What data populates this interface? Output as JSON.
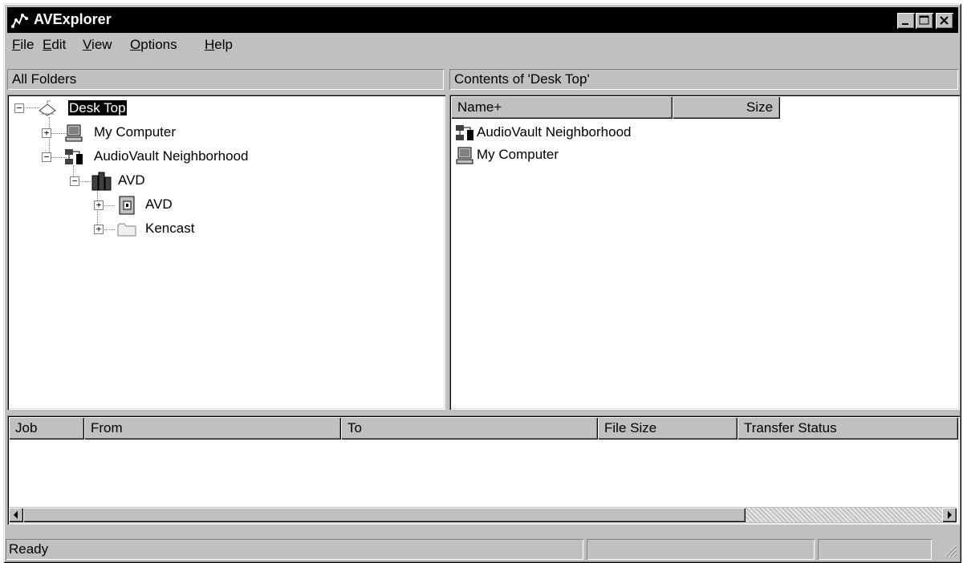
{
  "window": {
    "title": "AVExplorer",
    "icon": "av-network-icon",
    "controls": [
      "minimize",
      "maximize",
      "close"
    ]
  },
  "menu": {
    "file": "ile",
    "file_mnemonic": "F",
    "edit": "dit",
    "edit_mnemonic": "E",
    "view": "iew",
    "view_mnemonic": "V",
    "options": "ptions",
    "options_mnemonic": "O",
    "help": "elp",
    "help_mnemonic": "H"
  },
  "left_panel": {
    "header": "All Folders",
    "tree": [
      {
        "label": "Desk Top",
        "icon": "desktop-icon",
        "expander": "−",
        "selected": true
      },
      {
        "label": "My Computer",
        "icon": "computer-icon",
        "expander": "+"
      },
      {
        "label": "AudioVault Neighborhood",
        "icon": "network-icon",
        "expander": "−"
      },
      {
        "label": "AVD",
        "icon": "server-icon",
        "expander": "−"
      },
      {
        "label": "AVD",
        "icon": "drive-icon",
        "expander": "+"
      },
      {
        "label": "Kencast",
        "icon": "folder-icon",
        "expander": "+"
      }
    ]
  },
  "right_panel": {
    "header": "Contents of 'Desk Top'",
    "columns": [
      "Name+",
      "Size"
    ],
    "items": [
      {
        "name": "AudioVault Neighborhood",
        "icon": "network-icon"
      },
      {
        "name": "My Computer",
        "icon": "computer-icon"
      }
    ]
  },
  "jobs": {
    "columns": [
      "Job",
      "From",
      "To",
      "File Size",
      "Transfer Status"
    ]
  },
  "status_bar": {
    "text": "Ready"
  }
}
